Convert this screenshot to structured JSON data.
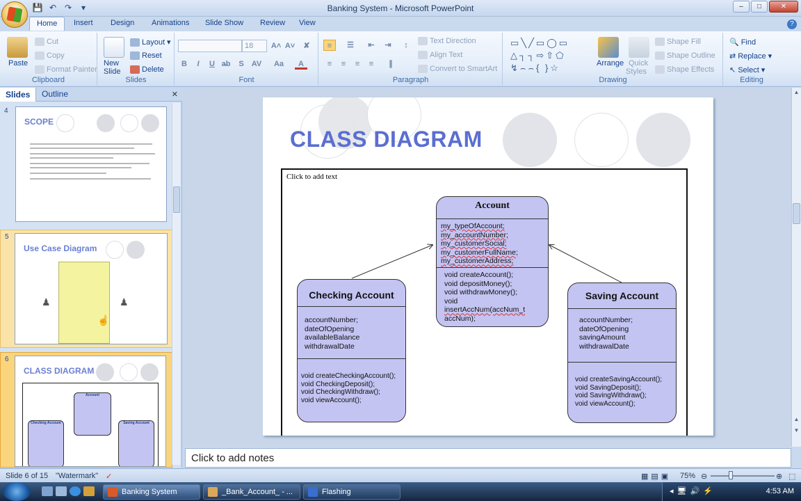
{
  "window": {
    "title": "Banking System - Microsoft PowerPoint"
  },
  "qat_icons": [
    "save-icon",
    "undo-icon",
    "redo-icon",
    "customize-icon"
  ],
  "tabs": [
    "Home",
    "Insert",
    "Design",
    "Animations",
    "Slide Show",
    "Review",
    "View"
  ],
  "ribbon": {
    "clipboard": {
      "label": "Clipboard",
      "paste": "Paste",
      "cut": "Cut",
      "copy": "Copy",
      "format_painter": "Format Painter"
    },
    "slides": {
      "label": "Slides",
      "new_slide_1": "New",
      "new_slide_2": "Slide",
      "layout": "Layout",
      "reset": "Reset",
      "delete": "Delete"
    },
    "font": {
      "label": "Font",
      "font_name": "",
      "font_size": "18"
    },
    "paragraph": {
      "label": "Paragraph",
      "text_direction": "Text Direction",
      "align_text": "Align Text",
      "convert_smartart": "Convert to SmartArt"
    },
    "drawing": {
      "label": "Drawing",
      "arrange": "Arrange",
      "quick_styles_1": "Quick",
      "quick_styles_2": "Styles",
      "shape_fill": "Shape Fill",
      "shape_outline": "Shape Outline",
      "shape_effects": "Shape Effects"
    },
    "editing": {
      "label": "Editing",
      "find": "Find",
      "replace": "Replace",
      "select": "Select"
    }
  },
  "left_pane": {
    "tab_slides": "Slides",
    "tab_outline": "Outline",
    "thumbnails": [
      {
        "number": "4",
        "title": "SCOPE"
      },
      {
        "number": "5",
        "title": "Use Case Diagram"
      },
      {
        "number": "6",
        "title": "CLASS DIAGRAM",
        "mini_classes": [
          "Account",
          "Checking Account",
          "Saving Account"
        ]
      }
    ]
  },
  "slide": {
    "title": "CLASS DIAGRAM",
    "placeholder": "Click to add text",
    "classes": {
      "account": {
        "name": "Account",
        "attributes": [
          "my_typeOfAccount;",
          "my_accountNumber;",
          "my_customerSocial;",
          "my_customerFullName;",
          "my_customerAddress;"
        ],
        "operations": [
          "void createAccount();",
          "void depositMoney();",
          "void withdrawMoney();",
          "void",
          "insertAccNum(accNum_t",
          "accNum);"
        ]
      },
      "checking": {
        "name": "Checking Account",
        "attributes": [
          "accountNumber;",
          "dateOfOpening",
          "availableBalance",
          "withdrawalDate"
        ],
        "operations": [
          "void createCheckingAccount();",
          "void CheckingDeposit();",
          "void CheckingWithdraw();",
          "void viewAccount();"
        ]
      },
      "saving": {
        "name": "Saving Account",
        "attributes": [
          "accountNumber;",
          "dateOfOpening",
          "savingAmount",
          "withdrawalDate"
        ],
        "operations": [
          "void createSavingAccount();",
          "void SavingDeposit();",
          "void SavingWithdraw();",
          "void viewAccount();"
        ]
      }
    }
  },
  "notes": {
    "placeholder": "Click to add notes"
  },
  "status": {
    "slide_of": "Slide 6 of 15",
    "theme": "\"Watermark\"",
    "zoom": "75%"
  },
  "taskbar": {
    "items": [
      "Banking System",
      "_Bank_Account_ - ...",
      "Flashing"
    ],
    "clock": "4:53 AM"
  }
}
